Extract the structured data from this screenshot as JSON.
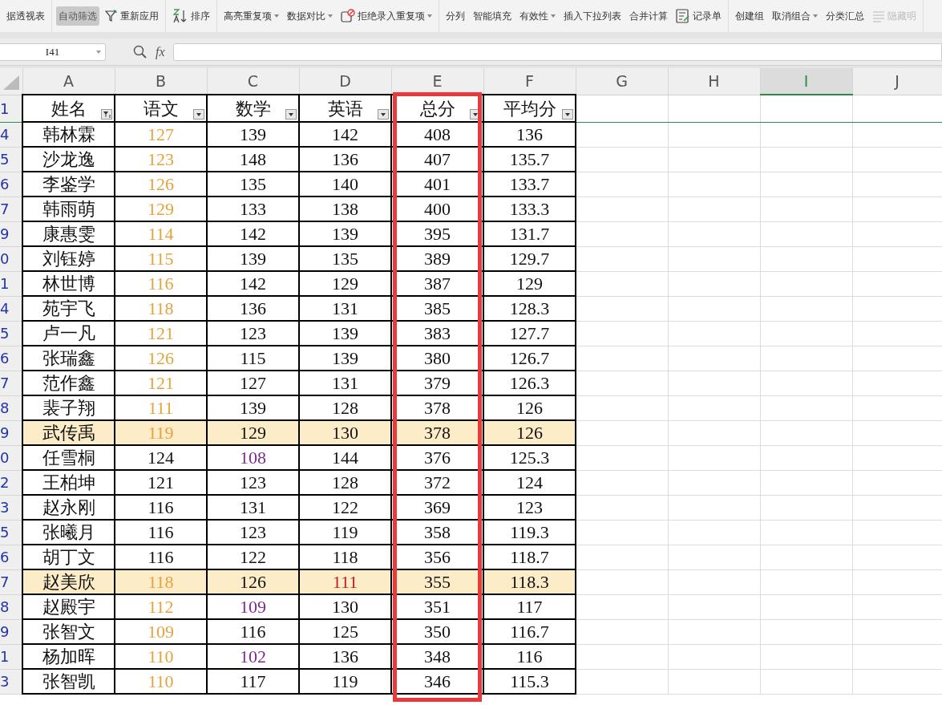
{
  "toolbar": {
    "groups": [
      [
        {
          "label": "据透视表",
          "kind": "plain",
          "dropdown": false,
          "selected": false,
          "disabled": false
        }
      ],
      [
        {
          "label": "自动筛选",
          "kind": "plain",
          "dropdown": false,
          "selected": true,
          "disabled": false
        },
        {
          "label": "重新应用",
          "kind": "funnel",
          "dropdown": false,
          "selected": false,
          "disabled": false
        }
      ],
      [
        {
          "label": "排序",
          "kind": "sort",
          "dropdown": false,
          "selected": false,
          "disabled": false
        }
      ],
      [
        {
          "label": "高亮重复项",
          "kind": "plain",
          "dropdown": true,
          "selected": false,
          "disabled": false
        },
        {
          "label": "数据对比",
          "kind": "plain",
          "dropdown": true,
          "selected": false,
          "disabled": false
        },
        {
          "label": "拒绝录入重复项",
          "kind": "block",
          "dropdown": true,
          "selected": false,
          "disabled": false
        }
      ],
      [
        {
          "label": "分列",
          "kind": "plain",
          "dropdown": false,
          "selected": false,
          "disabled": false
        },
        {
          "label": "智能填充",
          "kind": "plain",
          "dropdown": false,
          "selected": false,
          "disabled": false
        },
        {
          "label": "有效性",
          "kind": "plain",
          "dropdown": true,
          "selected": false,
          "disabled": false
        },
        {
          "label": "插入下拉列表",
          "kind": "plain",
          "dropdown": false,
          "selected": false,
          "disabled": false
        },
        {
          "label": "合并计算",
          "kind": "plain",
          "dropdown": false,
          "selected": false,
          "disabled": false
        },
        {
          "label": "记录单",
          "kind": "form",
          "dropdown": false,
          "selected": false,
          "disabled": false
        }
      ],
      [
        {
          "label": "创建组",
          "kind": "plain",
          "dropdown": false,
          "selected": false,
          "disabled": false
        },
        {
          "label": "取消组合",
          "kind": "plain",
          "dropdown": true,
          "selected": false,
          "disabled": false
        },
        {
          "label": "分类汇总",
          "kind": "plain",
          "dropdown": false,
          "selected": false,
          "disabled": false
        },
        {
          "label": "隐藏明",
          "kind": "list",
          "dropdown": false,
          "selected": false,
          "disabled": true
        }
      ]
    ]
  },
  "formula_bar": {
    "name_box": "I41",
    "fx": "fx"
  },
  "columns": [
    {
      "label": "A",
      "selected": false
    },
    {
      "label": "B",
      "selected": false
    },
    {
      "label": "C",
      "selected": false
    },
    {
      "label": "D",
      "selected": false
    },
    {
      "label": "E",
      "selected": false
    },
    {
      "label": "F",
      "selected": false
    },
    {
      "label": "G",
      "selected": false
    },
    {
      "label": "H",
      "selected": false
    },
    {
      "label": "I",
      "selected": true
    },
    {
      "label": "J",
      "selected": false
    }
  ],
  "header_row": {
    "number": "1",
    "cells": [
      {
        "text": "姓名",
        "filter_active": true
      },
      {
        "text": "语文",
        "filter_active": false
      },
      {
        "text": "数学",
        "filter_active": false
      },
      {
        "text": "英语",
        "filter_active": false
      },
      {
        "text": "总分",
        "filter_active": false
      },
      {
        "text": "平均分",
        "filter_active": false
      }
    ]
  },
  "rows": [
    {
      "number": "4",
      "highlighted": false,
      "cells": [
        "韩林霖",
        {
          "text": "127",
          "color": "#e6a23c"
        },
        "139",
        "142",
        "408",
        "136"
      ]
    },
    {
      "number": "5",
      "highlighted": false,
      "cells": [
        "沙龙逸",
        {
          "text": "123",
          "color": "#e6a23c"
        },
        "148",
        "136",
        "407",
        "135.7"
      ]
    },
    {
      "number": "6",
      "highlighted": false,
      "cells": [
        "李鉴学",
        {
          "text": "126",
          "color": "#e6a23c"
        },
        "135",
        "140",
        "401",
        "133.7"
      ]
    },
    {
      "number": "7",
      "highlighted": false,
      "cells": [
        "韩雨萌",
        {
          "text": "129",
          "color": "#e6a23c"
        },
        "133",
        "138",
        "400",
        "133.3"
      ]
    },
    {
      "number": "9",
      "highlighted": false,
      "cells": [
        "康惠雯",
        {
          "text": "114",
          "color": "#e6a23c"
        },
        "142",
        "139",
        "395",
        "131.7"
      ]
    },
    {
      "number": "0",
      "highlighted": false,
      "cells": [
        "刘钰婷",
        {
          "text": "115",
          "color": "#e6a23c"
        },
        "139",
        "135",
        "389",
        "129.7"
      ]
    },
    {
      "number": "1",
      "highlighted": false,
      "cells": [
        "林世博",
        {
          "text": "116",
          "color": "#e6a23c"
        },
        "142",
        "129",
        "387",
        "129"
      ]
    },
    {
      "number": "4",
      "highlighted": false,
      "cells": [
        "苑宇飞",
        {
          "text": "118",
          "color": "#e6a23c"
        },
        "136",
        "131",
        "385",
        "128.3"
      ]
    },
    {
      "number": "5",
      "highlighted": false,
      "cells": [
        "卢一凡",
        {
          "text": "121",
          "color": "#e6a23c"
        },
        "123",
        "139",
        "383",
        "127.7"
      ]
    },
    {
      "number": "6",
      "highlighted": false,
      "cells": [
        "张瑞鑫",
        {
          "text": "126",
          "color": "#e6a23c"
        },
        "115",
        "139",
        "380",
        "126.7"
      ]
    },
    {
      "number": "7",
      "highlighted": false,
      "cells": [
        "范作鑫",
        {
          "text": "121",
          "color": "#e6a23c"
        },
        "127",
        "131",
        "379",
        "126.3"
      ]
    },
    {
      "number": "8",
      "highlighted": false,
      "cells": [
        "裴子翔",
        {
          "text": "111",
          "color": "#e6a23c"
        },
        "139",
        "128",
        "378",
        "126"
      ]
    },
    {
      "number": "9",
      "highlighted": true,
      "cells": [
        "武传禹",
        {
          "text": "119",
          "color": "#e6a23c"
        },
        "129",
        "130",
        "378",
        "126"
      ]
    },
    {
      "number": "0",
      "highlighted": false,
      "cells": [
        "任雪桐",
        "124",
        {
          "text": "108",
          "color": "#7b2b8f"
        },
        "144",
        "376",
        "125.3"
      ]
    },
    {
      "number": "2",
      "highlighted": false,
      "cells": [
        "王柏坤",
        "121",
        "123",
        "128",
        "372",
        "124"
      ]
    },
    {
      "number": "3",
      "highlighted": false,
      "cells": [
        "赵永刚",
        "116",
        "131",
        "122",
        "369",
        "123"
      ]
    },
    {
      "number": "5",
      "highlighted": false,
      "cells": [
        "张曦月",
        "116",
        "123",
        "119",
        "358",
        "119.3"
      ]
    },
    {
      "number": "6",
      "highlighted": false,
      "cells": [
        "胡丁文",
        "116",
        "122",
        "118",
        "356",
        "118.7"
      ]
    },
    {
      "number": "7",
      "highlighted": true,
      "cells": [
        "赵美欣",
        {
          "text": "118",
          "color": "#e6a23c"
        },
        "126",
        {
          "text": "111",
          "color": "#c0201f"
        },
        "355",
        "118.3"
      ]
    },
    {
      "number": "8",
      "highlighted": false,
      "cells": [
        "赵殿宇",
        {
          "text": "112",
          "color": "#e6a23c"
        },
        {
          "text": "109",
          "color": "#7b2b8f"
        },
        "130",
        "351",
        "117"
      ]
    },
    {
      "number": "9",
      "highlighted": false,
      "cells": [
        "张智文",
        {
          "text": "109",
          "color": "#e6a23c"
        },
        "116",
        "125",
        "350",
        "116.7"
      ]
    },
    {
      "number": "1",
      "highlighted": false,
      "cells": [
        "杨加晖",
        {
          "text": "110",
          "color": "#e6a23c"
        },
        {
          "text": "102",
          "color": "#7b2b8f"
        },
        "136",
        "348",
        "116"
      ]
    },
    {
      "number": "3",
      "highlighted": false,
      "cells": [
        "张智凯",
        {
          "text": "110",
          "color": "#e6a23c"
        },
        "117",
        "119",
        "346",
        "115.3"
      ]
    }
  ],
  "annotation": {
    "kind": "frame"
  }
}
